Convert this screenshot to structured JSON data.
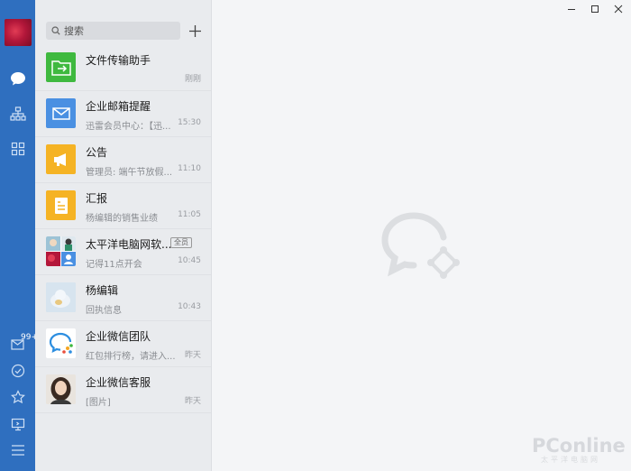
{
  "search": {
    "placeholder": "搜索"
  },
  "sidebar": {
    "mail_badge": "99+"
  },
  "conversations": [
    {
      "title": "文件传输助手",
      "preview": "",
      "time": "刚刚",
      "icon": "file-transfer-icon",
      "color": "#3fb93f"
    },
    {
      "title": "企业邮箱提醒",
      "preview": "迅雷会员中心：【迅...",
      "time": "15:30",
      "icon": "mail-icon",
      "color": "#4a90e2"
    },
    {
      "title": "公告",
      "preview": "管理员: 端午节放假...",
      "time": "11:10",
      "icon": "megaphone-icon",
      "color": "#f5b324"
    },
    {
      "title": "汇报",
      "preview": "杨编辑的销售业绩",
      "time": "11:05",
      "icon": "report-icon",
      "color": "#f5b324"
    },
    {
      "title": "太平洋电脑网软...",
      "tag": "全员",
      "preview": "记得11点开会",
      "time": "10:45",
      "icon": "group-avatar-icon"
    },
    {
      "title": "杨编辑",
      "preview": "回执信息",
      "time": "10:43",
      "icon": "user-avatar-icon"
    },
    {
      "title": "企业微信团队",
      "preview": "红包排行榜，请进入...",
      "time": "昨天",
      "icon": "wework-logo-icon"
    },
    {
      "title": "企业微信客服",
      "preview": "[图片]",
      "time": "昨天",
      "icon": "service-avatar-icon"
    }
  ],
  "watermark": {
    "brand": "PConline",
    "sub": "太平洋电脑网"
  }
}
